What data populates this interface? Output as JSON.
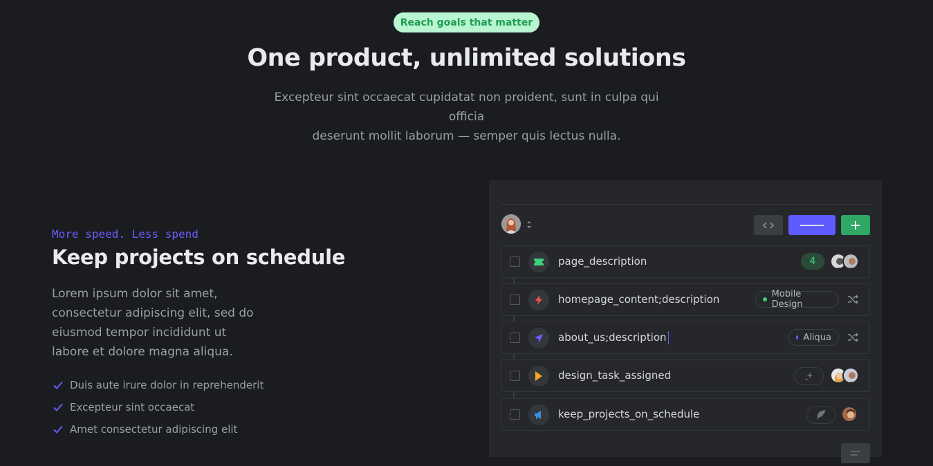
{
  "hero": {
    "badge": "Reach goals that matter",
    "title": "One product, unlimited solutions",
    "subtitle_line1": "Excepteur sint occaecat cupidatat non proident, sunt in culpa qui officia",
    "subtitle_line2": "deserunt mollit laborum — semper quis lectus nulla."
  },
  "feature": {
    "eyebrow": "More speed. Less spend",
    "title": "Keep projects on schedule",
    "body": "Lorem ipsum dolor sit amet, consectetur adipiscing elit, sed do eiusmod tempor incididunt ut labore et dolore magna aliqua.",
    "checks": [
      "Duis aute irure dolor in reprehenderit",
      "Excepteur sint occaecat",
      "Amet consectetur adipiscing elit"
    ]
  },
  "panel": {
    "rows": [
      {
        "label": "page_description",
        "icon": "ticket-icon",
        "count": "4"
      },
      {
        "label": "homepage_content;description",
        "icon": "bolt-icon",
        "tag": "Mobile Design"
      },
      {
        "label": "about_us;description",
        "icon": "navigation-arrow-icon",
        "tag": "Aliqua"
      },
      {
        "label": "design_task_assigned",
        "icon": "play-icon"
      },
      {
        "label": "keep_projects_on_schedule",
        "icon": "megaphone-icon"
      }
    ]
  },
  "colors": {
    "background": "#1b1c1f",
    "accent_purple": "#6d5cff",
    "accent_green": "#2ea864",
    "badge_bg": "#b9f5d0"
  }
}
